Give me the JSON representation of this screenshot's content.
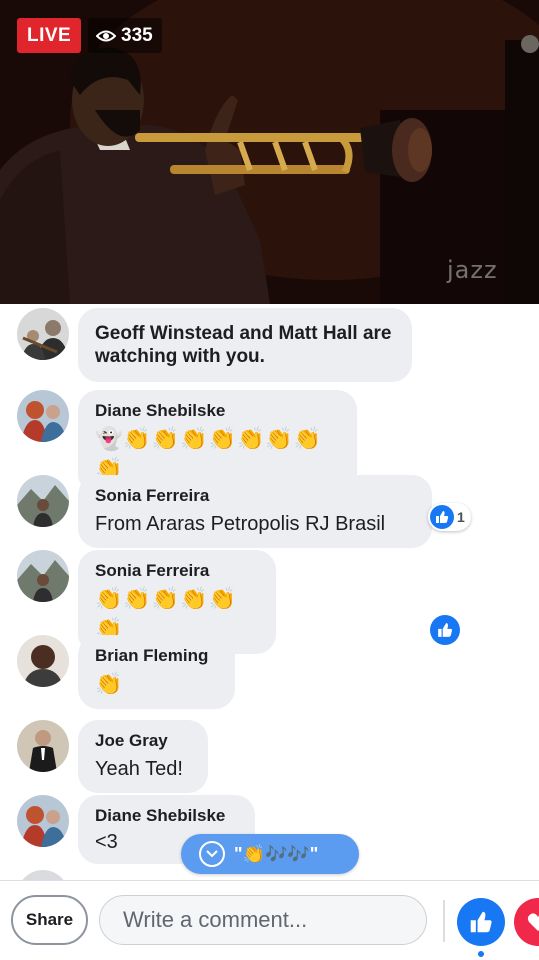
{
  "video": {
    "live_label": "LIVE",
    "viewer_count": "335",
    "watermark": "jazz"
  },
  "comments": [
    {
      "type": "system",
      "text": "Geoff Winstead and Matt Hall are watching with you."
    },
    {
      "name": "Diane Shebilske",
      "text": "👻👏👏👏👏👏👏👏👏"
    },
    {
      "name": "Sonia Ferreira",
      "text": "From Araras Petropolis RJ Brasil",
      "likes": "1"
    },
    {
      "name": "Sonia Ferreira",
      "text": "👏👏👏👏👏👏"
    },
    {
      "name": "Brian Fleming",
      "text": "👏"
    },
    {
      "name": "Joe Gray",
      "text": "Yeah Ted!"
    },
    {
      "name": "Diane Shebilske",
      "text": "<3"
    }
  ],
  "new_comments_pill": {
    "text": "\"👏🎶🎶\""
  },
  "bottom_bar": {
    "share_label": "Share",
    "comment_placeholder": "Write a comment..."
  },
  "colors": {
    "live_red": "#e0262c",
    "facebook_blue": "#1877f2",
    "bubble_gray": "#eceef1",
    "love_red": "#f0284a"
  }
}
